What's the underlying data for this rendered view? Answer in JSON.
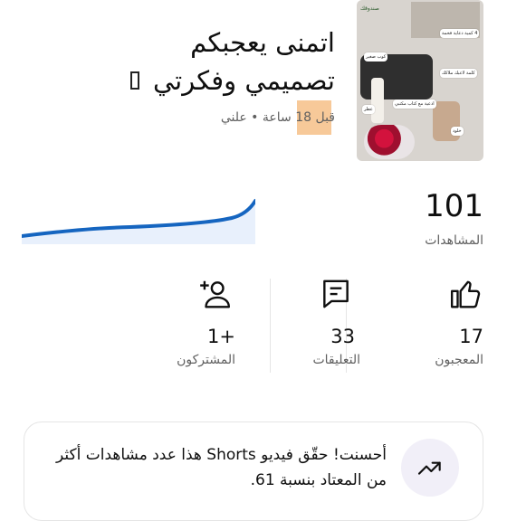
{
  "video": {
    "title": "اتمنى يعجبكم تصميمي وفكرتي",
    "meta": "قبل 18 ساعة • علني",
    "thumbnail": {
      "top_label": "صندوقك",
      "tags": [
        "4 كمية دعاية فخمة",
        "كلمة لاعبك ملاكك",
        "كوب صغير",
        "ادعية مع كتاب مكتبي",
        "عطر",
        "الوردة",
        "خلود"
      ]
    }
  },
  "views": {
    "count": "101",
    "label": "المشاهدات"
  },
  "stats": {
    "likes": {
      "value": "17",
      "label": "المعجبون",
      "icon": "thumbs-up-icon"
    },
    "comments": {
      "value": "33",
      "label": "التعليقات",
      "icon": "comment-icon"
    },
    "subscribers": {
      "value": "1+",
      "label": "المشتركون",
      "icon": "add-person-icon"
    }
  },
  "insight": {
    "icon": "trending-up-icon",
    "message": "أحسنت! حقّق فيديو Shorts هذا عدد مشاهدات أكثر من المعتاد بنسبة 61."
  },
  "colors": {
    "accent": "#1565c0",
    "spark_fill": "#e8f0fc",
    "badge_bg": "#f1eff8"
  }
}
